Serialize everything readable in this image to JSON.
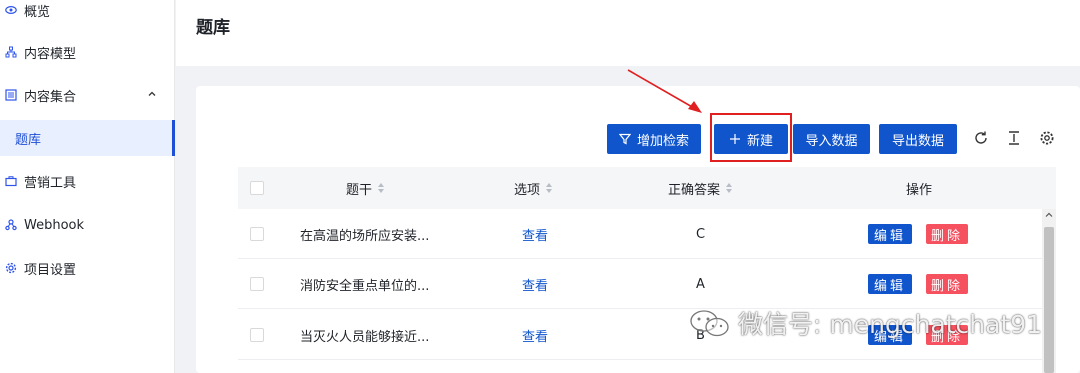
{
  "sidebar": {
    "items": [
      {
        "label": "概览",
        "icon": "eye-icon"
      },
      {
        "label": "内容模型",
        "icon": "sitemap-icon"
      },
      {
        "label": "内容集合",
        "icon": "list-icon",
        "expanded": true
      },
      {
        "label": "题库",
        "active": true
      },
      {
        "label": "营销工具",
        "icon": "briefcase-icon"
      },
      {
        "label": "Webhook",
        "icon": "webhook-icon"
      },
      {
        "label": "项目设置",
        "icon": "gear-icon"
      }
    ]
  },
  "header": {
    "title": "题库"
  },
  "toolbar": {
    "add_filter_label": "增加检索",
    "new_label": "新建",
    "import_label": "导入数据",
    "export_label": "导出数据"
  },
  "table": {
    "columns": [
      "题干",
      "选项",
      "正确答案",
      "操作"
    ],
    "rows": [
      {
        "stem": "在高温的场所应安装...",
        "options": "查看",
        "answer": "C",
        "edit": "编辑",
        "delete": "删除"
      },
      {
        "stem": "消防安全重点单位的...",
        "options": "查看",
        "answer": "A",
        "edit": "编辑",
        "delete": "删除"
      },
      {
        "stem": "当灭火人员能够接近...",
        "options": "查看",
        "answer": "B",
        "edit": "编辑",
        "delete": "删除"
      }
    ]
  },
  "watermark": {
    "text": "微信号: mengchatchat91"
  },
  "colors": {
    "primary": "#1155cc",
    "danger": "#f5515f",
    "annotation": "#e02020"
  }
}
